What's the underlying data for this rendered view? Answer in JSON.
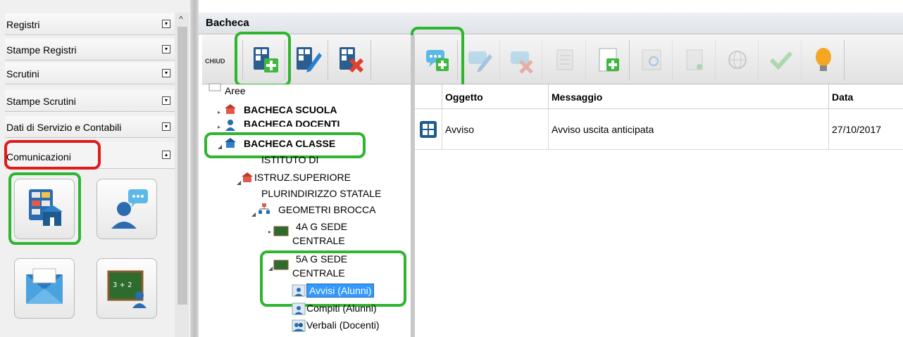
{
  "sidebar": {
    "items": [
      {
        "label": "Registri",
        "toggle": "▾"
      },
      {
        "label": "Stampe Registri",
        "toggle": "▾"
      },
      {
        "label": "Scrutini",
        "toggle": "▾"
      },
      {
        "label": "Stampe Scrutini",
        "toggle": "▾"
      },
      {
        "label": "Dati di Servizio e Contabili",
        "toggle": "▾"
      },
      {
        "label": "Comunicazioni",
        "toggle": "▴"
      }
    ],
    "scroll_up": "^",
    "tiles": [
      "bacheca-icon",
      "messaggi-icon",
      "email-icon",
      "lavagna-icon"
    ]
  },
  "panel": {
    "title": "Bacheca",
    "chiudi_label": "CHIUD"
  },
  "tree": {
    "root": "Aree",
    "items": {
      "scuola": "BACHECA SCUOLA",
      "docenti": "BACHECA DOCENTI",
      "classe": "BACHECA CLASSE",
      "istituto_1": "ISTITUTO DI",
      "istituto_2": "ISTRUZ.SUPERIORE",
      "istituto_3": "PLURINDIRIZZO STATALE",
      "geometri": "GEOMETRI BROCCA",
      "classe4a_1": "4A G SEDE",
      "classe4a_2": "CENTRALE",
      "classe5a_1": "5A G SEDE",
      "classe5a_2": "CENTRALE",
      "avvisi": "Avvisi (Alunni)",
      "compiti": "Compiti (Alunni)",
      "verbali": "Verbali (Docenti)"
    }
  },
  "grid": {
    "columns": [
      "Oggetto",
      "Messaggio",
      "Data"
    ],
    "rows": [
      {
        "oggetto": "Avviso",
        "messaggio": "Avviso uscita anticipata",
        "data": "27/10/2017"
      }
    ]
  },
  "colors": {
    "highlight_green": "#2fb52f",
    "highlight_red": "#e01b1b",
    "selection_blue": "#3399ff"
  }
}
